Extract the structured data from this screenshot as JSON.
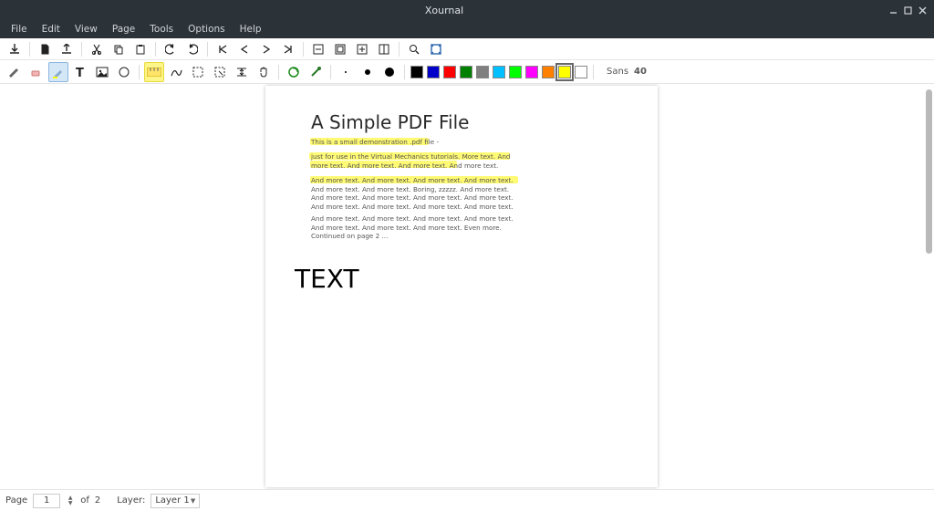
{
  "app": {
    "title": "Xournal"
  },
  "menu": {
    "file": "File",
    "edit": "Edit",
    "view": "View",
    "page": "Page",
    "tools": "Tools",
    "options": "Options",
    "help": "Help"
  },
  "font": {
    "family": "Sans",
    "size": "40"
  },
  "colors": {
    "black": "#000000",
    "white": "#ffffff",
    "red": "#ff0000",
    "green": "#008000",
    "blue": "#0000c8",
    "gray": "#808080",
    "lightblue": "#00c0ff",
    "lightgreen": "#00ff00",
    "magenta": "#ff00ff",
    "orange": "#ff8000",
    "yellow": "#ffff00"
  },
  "document": {
    "title": "A Simple PDF File",
    "p1": "This is a small demonstration .pdf file -",
    "p2a": "just for use in the Virtual Mechanics tutorials. More text. And more",
    "p2b": "text. And more text. And more text. And more text.",
    "p3a": "And more text. And more text. And more text. And more text. And more",
    "p3b": "text. And more text. Boring, zzzzz. And more text. And more text. And more text. And more text. And more text. And more text. And more text. And more text. And more text.",
    "p4": "And more text. And more text. And more text. And more text. And more text. And more text. And more text. Even more. Continued on page 2 ...",
    "annotation": "TEXT"
  },
  "status": {
    "page_label": "Page",
    "current_page": "1",
    "of": "of",
    "total_pages": "2",
    "layer_label": "Layer:",
    "layer_value": "Layer 1"
  }
}
